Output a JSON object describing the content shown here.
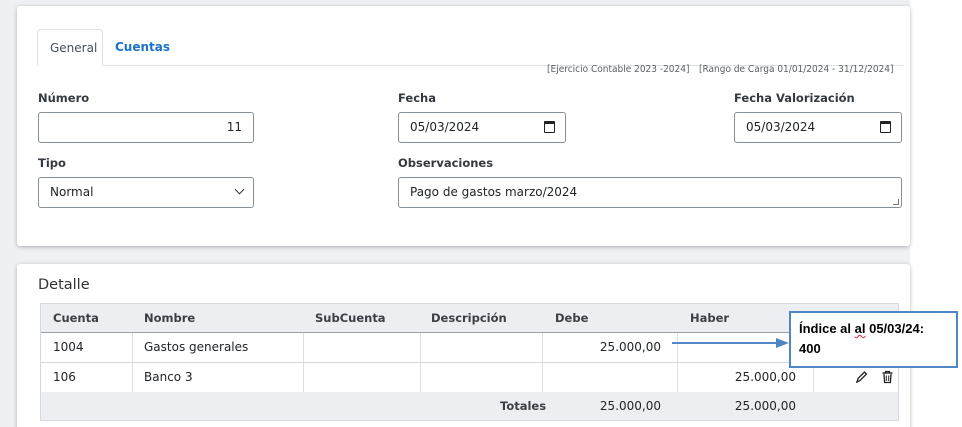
{
  "tabs": {
    "general": "General",
    "cuentas": "Cuentas"
  },
  "meta": {
    "ejercicio": "[Ejercicio Contable 2023 -2024]",
    "rango": "[Rango de Carga  01/01/2024  -  31/12/2024]"
  },
  "form": {
    "numero": {
      "label": "Número",
      "value": "11"
    },
    "fecha": {
      "label": "Fecha",
      "value": "05/03/2024"
    },
    "fecha_valorizacion": {
      "label": "Fecha Valorización",
      "value": "05/03/2024"
    },
    "tipo": {
      "label": "Tipo",
      "value": "Normal"
    },
    "observaciones": {
      "label": "Observaciones",
      "value": "Pago de gastos marzo/2024"
    }
  },
  "detalle": {
    "title": "Detalle",
    "columns": [
      "Cuenta",
      "Nombre",
      "SubCuenta",
      "Descripción",
      "Debe",
      "Haber"
    ],
    "rows": [
      {
        "cuenta": "1004",
        "nombre": "Gastos generales",
        "subcuenta": "",
        "descripcion": "",
        "debe": "25.000,00",
        "haber": ""
      },
      {
        "cuenta": "106",
        "nombre": "Banco 3",
        "subcuenta": "",
        "descripcion": "",
        "debe": "",
        "haber": "25.000,00"
      }
    ],
    "totales": {
      "label": "Totales",
      "debe": "25.000,00",
      "haber": "25.000,00"
    }
  },
  "annotation": {
    "prefix": "Índice al ",
    "misspelled": "al",
    "suffix": " 05/03/24:",
    "value": "400",
    "color": "#4f86c6"
  },
  "icons": {
    "edit": "pencil-icon",
    "delete": "trash-icon"
  }
}
